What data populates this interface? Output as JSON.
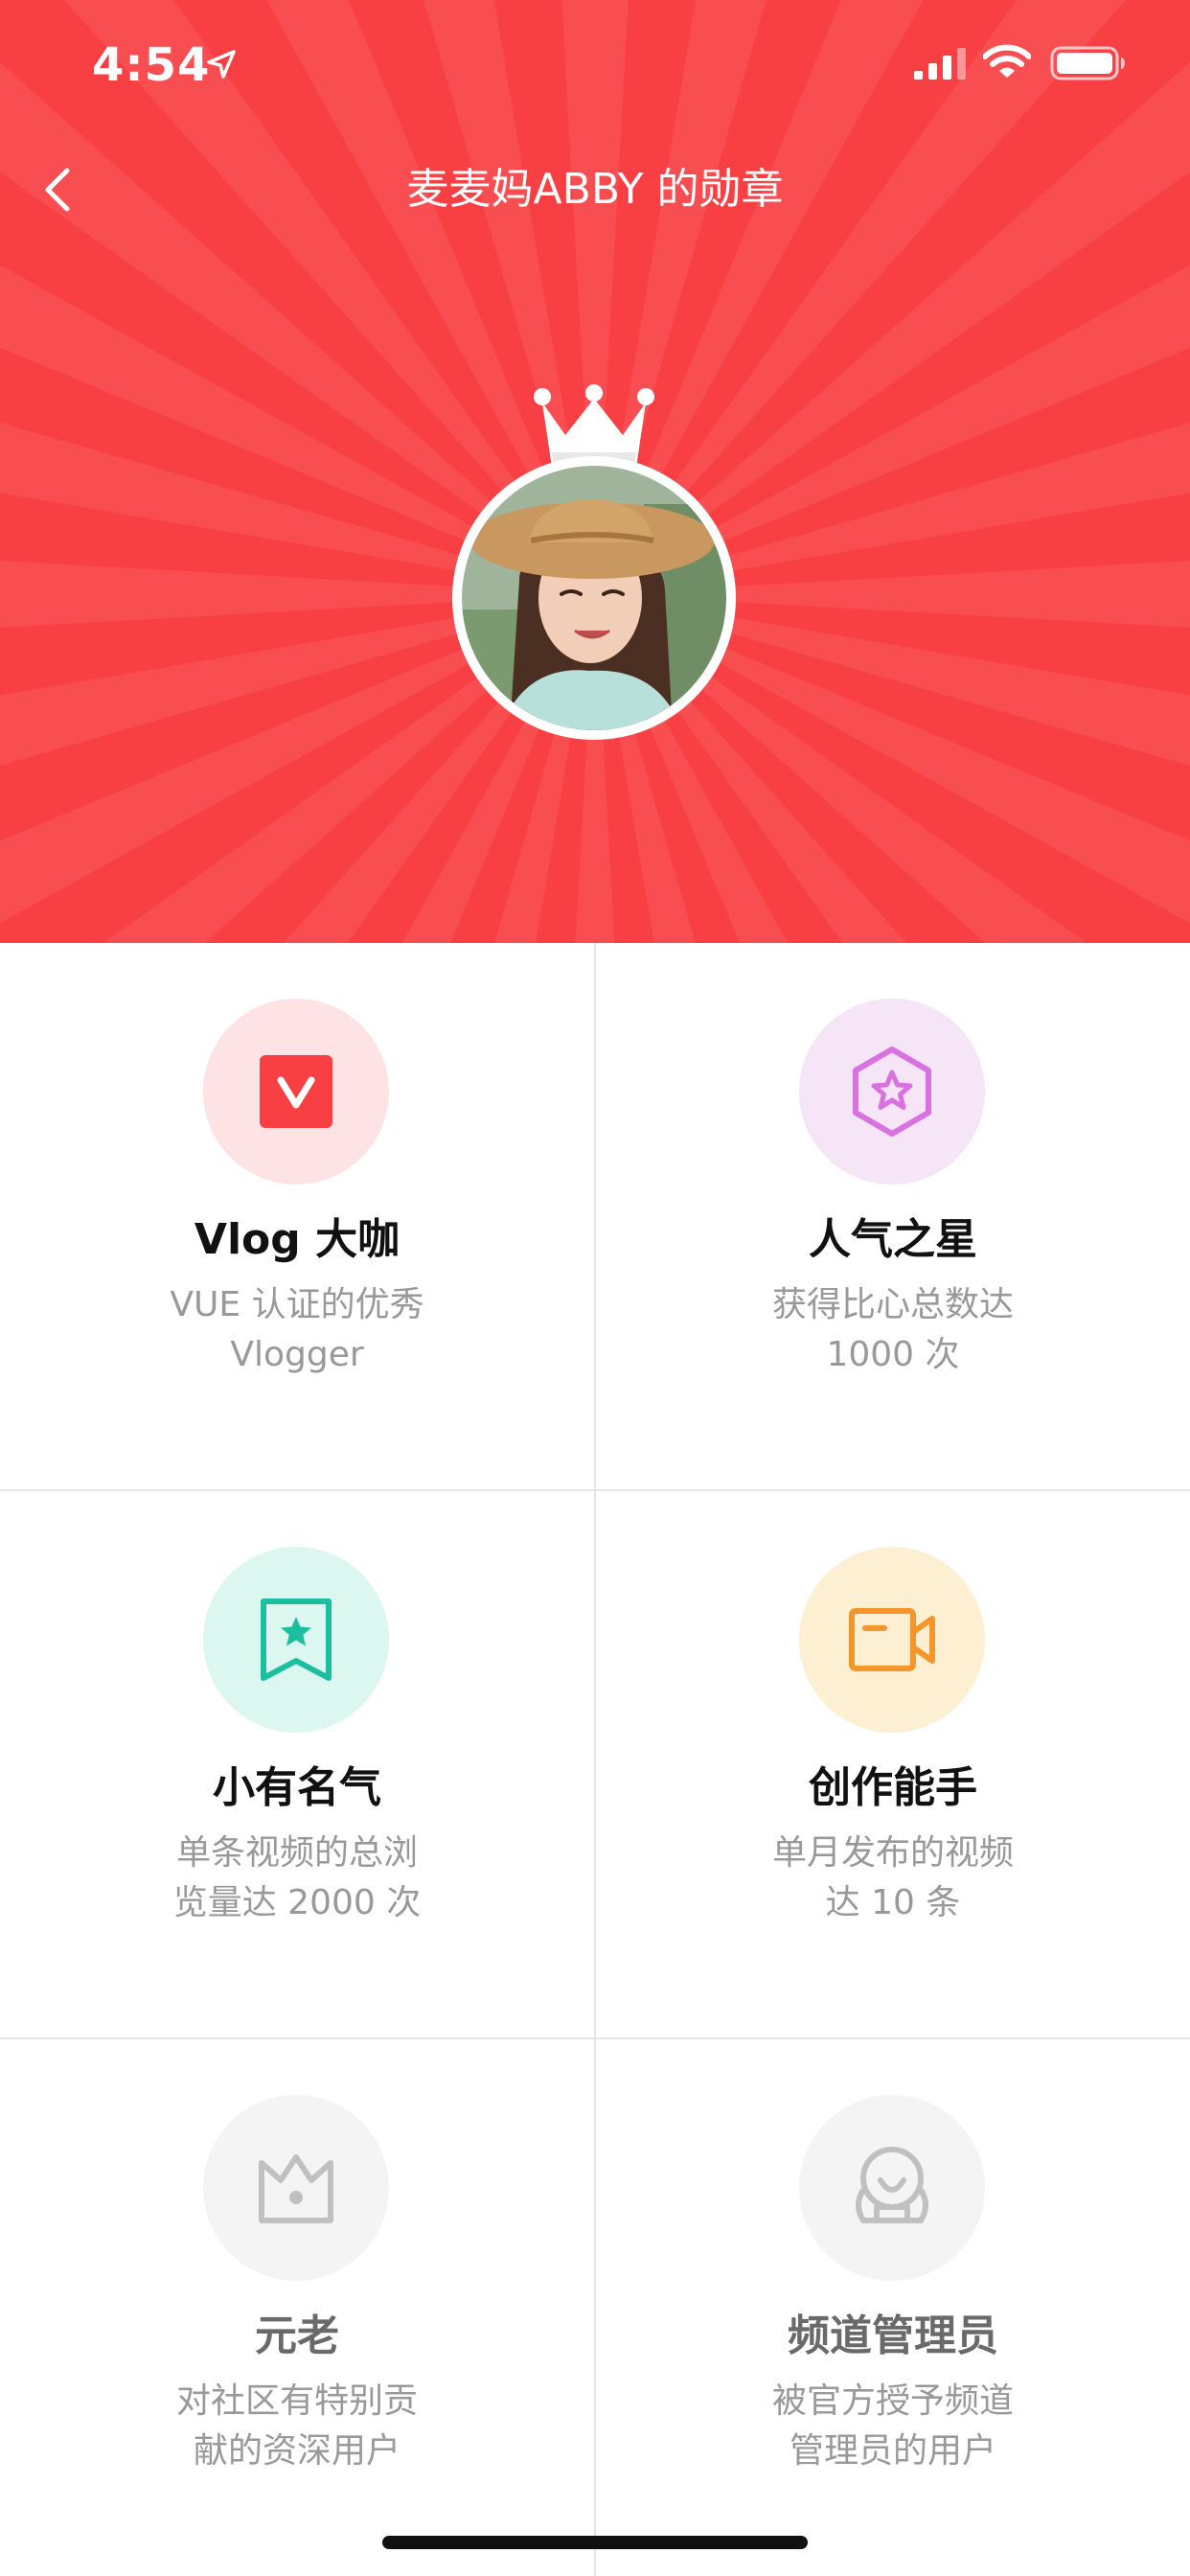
{
  "status_bar": {
    "time": "4:54",
    "icons": [
      "location-arrow-icon",
      "signal-icon",
      "wifi-icon",
      "battery-icon"
    ]
  },
  "nav": {
    "title": "麦麦妈ABBY 的勋章",
    "back_icon": "chevron-left-icon"
  },
  "colors": {
    "hero_background": "#f84044",
    "vlog_badge": "#f84044",
    "popular_badge": "#d972e0",
    "famous_badge": "#1bbfa0",
    "creator_badge": "#f5962c",
    "locked_badge": "#c0c0c0"
  },
  "badges": [
    {
      "name": "Vlog 大咖",
      "desc_line1": "VUE 认证的优秀",
      "desc_line2": "Vlogger",
      "icon": "v-square-icon",
      "unlocked": true
    },
    {
      "name": "人气之星",
      "desc_line1": "获得比心总数达",
      "desc_line2": "1000 次",
      "icon": "hexagon-star-icon",
      "unlocked": true
    },
    {
      "name": "小有名气",
      "desc_line1": "单条视频的总浏",
      "desc_line2": "览量达 2000 次",
      "icon": "bookmark-star-icon",
      "unlocked": true
    },
    {
      "name": "创作能手",
      "desc_line1": "单月发布的视频",
      "desc_line2": "达 10 条",
      "icon": "video-camera-icon",
      "unlocked": true
    },
    {
      "name": "元老",
      "desc_line1": "对社区有特别贡",
      "desc_line2": "献的资深用户",
      "icon": "crown-outline-icon",
      "unlocked": false
    },
    {
      "name": "频道管理员",
      "desc_line1": "被官方授予频道",
      "desc_line2": "管理员的用户",
      "icon": "admin-figure-icon",
      "unlocked": false
    }
  ]
}
